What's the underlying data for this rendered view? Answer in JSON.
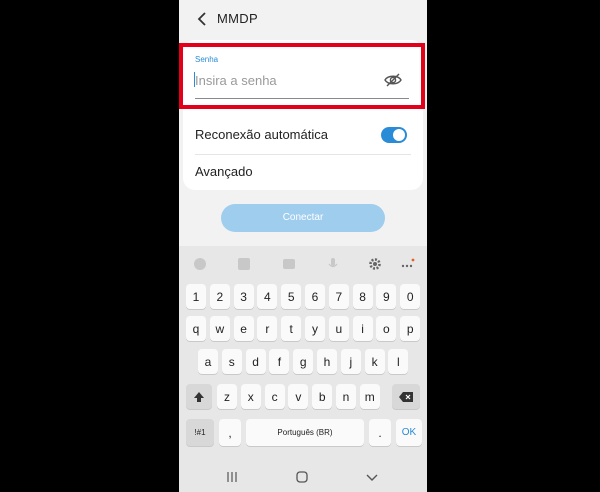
{
  "header": {
    "title": "MMDP"
  },
  "password": {
    "label": "Senha",
    "placeholder": "Insira a senha",
    "value": ""
  },
  "settings": {
    "reconnect_label": "Reconexão automática",
    "reconnect_on": true,
    "advanced_label": "Avançado"
  },
  "connect_label": "Conectar",
  "keyboard": {
    "row_numbers": [
      "1",
      "2",
      "3",
      "4",
      "5",
      "6",
      "7",
      "8",
      "9",
      "0"
    ],
    "row_q": [
      "q",
      "w",
      "e",
      "r",
      "t",
      "y",
      "u",
      "i",
      "o",
      "p"
    ],
    "row_a": [
      "a",
      "s",
      "d",
      "f",
      "g",
      "h",
      "j",
      "k",
      "l"
    ],
    "row_z": [
      "z",
      "x",
      "c",
      "v",
      "b",
      "n",
      "m"
    ],
    "symbols_label": "!#1",
    "comma_label": ",",
    "space_label": "Português (BR)",
    "period_label": ".",
    "ok_label": "OK"
  },
  "colors": {
    "accent": "#2a8bd6",
    "highlight_border": "#e3001b",
    "connect_disabled": "#9fcdee"
  }
}
